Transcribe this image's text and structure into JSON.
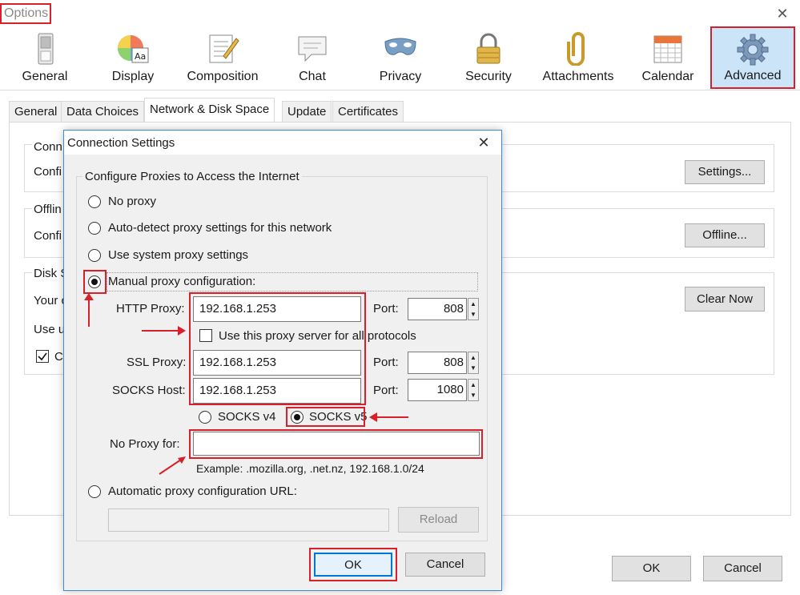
{
  "window": {
    "title": "Options",
    "close_glyph": "✕"
  },
  "toolbar": {
    "items": [
      {
        "label": "General",
        "icon": "switch-icon"
      },
      {
        "label": "Display",
        "icon": "palette-icon"
      },
      {
        "label": "Composition",
        "icon": "compose-icon"
      },
      {
        "label": "Chat",
        "icon": "chat-bubble-icon"
      },
      {
        "label": "Privacy",
        "icon": "mask-icon"
      },
      {
        "label": "Security",
        "icon": "padlock-icon"
      },
      {
        "label": "Attachments",
        "icon": "paperclip-icon"
      },
      {
        "label": "Calendar",
        "icon": "calendar-icon"
      },
      {
        "label": "Advanced",
        "icon": "gear-icon",
        "selected": true
      }
    ]
  },
  "tabs": [
    "General",
    "Data Choices",
    "Network & Disk Space",
    "Update",
    "Certificates"
  ],
  "active_tab": "Network & Disk Space",
  "background": {
    "connection_heading": "Conn",
    "connection_text": "Confi",
    "settings_button": "Settings...",
    "offline_heading": "Offlin",
    "offline_text": "Confi",
    "offline_button": "Offline...",
    "disk_heading": "Disk S",
    "disk_text1": "Your c",
    "disk_text2": "Use u",
    "disk_check_label": "C",
    "clear_now_button": "Clear Now",
    "ok_button": "OK",
    "cancel_button": "Cancel"
  },
  "dialog": {
    "title": "Connection Settings",
    "close_glyph": "✕",
    "group_label": "Configure Proxies to Access the Internet",
    "options": {
      "no_proxy": "No proxy",
      "auto_detect": "Auto-detect proxy settings for this network",
      "system": "Use system proxy settings",
      "manual": "Manual proxy configuration:",
      "auto_url": "Automatic proxy configuration URL:"
    },
    "selected_option": "manual",
    "http_proxy_label": "HTTP Proxy:",
    "http_proxy_value": "192.168.1.253",
    "http_port_label": "Port:",
    "http_port_value": "808",
    "use_all_label": "Use this proxy server for all protocols",
    "ssl_proxy_label": "SSL Proxy:",
    "ssl_proxy_value": "192.168.1.253",
    "ssl_port_label": "Port:",
    "ssl_port_value": "808",
    "socks_host_label": "SOCKS Host:",
    "socks_host_value": "192.168.1.253",
    "socks_port_label": "Port:",
    "socks_port_value": "1080",
    "socks_v4": "SOCKS v4",
    "socks_v5": "SOCKS v5",
    "socks_selected": "v5",
    "no_proxy_label": "No Proxy for:",
    "no_proxy_value": "",
    "example": "Example: .mozilla.org, .net.nz, 192.168.1.0/24",
    "auto_url_value": "",
    "reload_button": "Reload",
    "ok_button": "OK",
    "cancel_button": "Cancel"
  },
  "colors": {
    "highlight_red": "#d9202a",
    "selected_tab_bg": "#cce4f7",
    "dialog_border": "#3c8ad6"
  }
}
